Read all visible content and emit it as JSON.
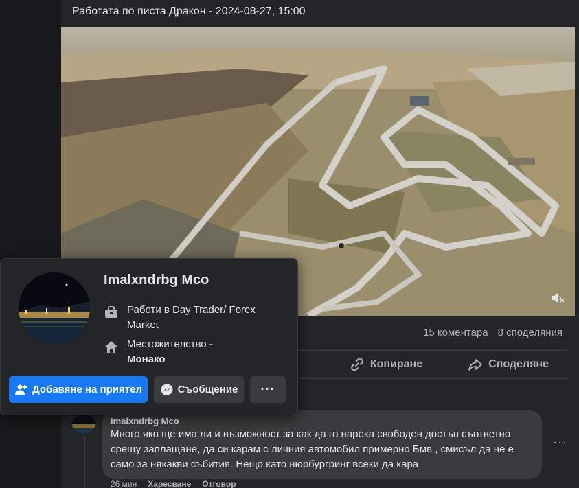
{
  "post": {
    "title": "Работата по писта Дракон - 2024-08-27, 15:00"
  },
  "stats": {
    "comments": "15 коментара",
    "shares": "8 споделяния"
  },
  "actions": {
    "copy_label": "Копиране",
    "share_label": "Споделяне"
  },
  "profile_card": {
    "name": "Imalxndrbg Mco",
    "work": "Работи в Day Trader/ Forex Market",
    "location_prefix": "Местожителство -",
    "location_value": "Монако",
    "add_friend_label": "Добавяне на приятел",
    "message_label": "Съобщение",
    "more_label": "···"
  },
  "comment": {
    "author": "Imalxndrbg Mco",
    "text": "Много яко ще има ли и възможност за как да го нарека свободен достъп съответно срещу заплащане, да си карам с личния автомобил примерно Бмв , смисъл да не е само за някакви събития. Нещо като нюрбургринг всеки да кара",
    "time": "26 мин",
    "like_label": "Харесване",
    "reply_label": "Отговор",
    "more_label": "···"
  },
  "colors": {
    "background": "#18191a",
    "card": "#242526",
    "bubble": "#3a3b3c",
    "accent": "#1877f2",
    "text_primary": "#e4e6eb",
    "text_secondary": "#b0b3b8"
  },
  "icons": {
    "mute": "speaker-muted-icon",
    "copy": "link-icon",
    "share": "share-arrow-icon",
    "work": "briefcase-icon",
    "home": "house-icon",
    "add_friend": "person-plus-icon",
    "message": "messenger-icon"
  }
}
